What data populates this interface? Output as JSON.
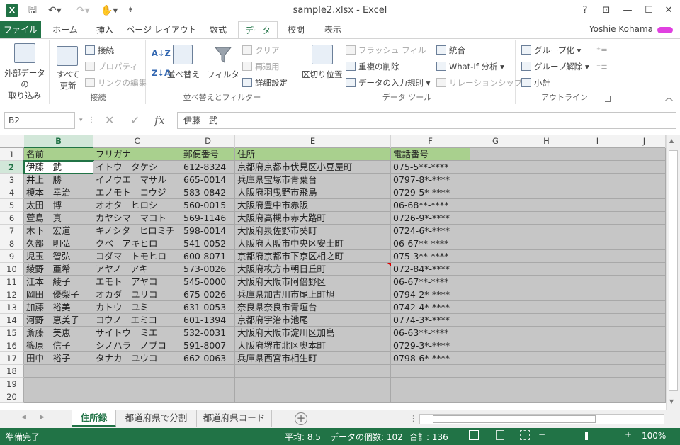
{
  "title_bar": {
    "app_icon": "X",
    "window_title": "sample2.xlsx - Excel",
    "help": "?",
    "ribbon_display": "⊡",
    "minimize": "—",
    "maximize": "☐",
    "close": "✕"
  },
  "tabs": [
    "ファイル",
    "ホーム",
    "挿入",
    "ページ レイアウト",
    "数式",
    "データ",
    "校閲",
    "表示"
  ],
  "active_tab": "データ",
  "user": "Yoshie Kohama",
  "ribbon": {
    "external": {
      "label": "外部データの\n取り込み"
    },
    "connections": {
      "refresh": "すべて\n更新",
      "connect": "接続",
      "properties": "プロパティ",
      "edit_links": "リンクの編集",
      "group_label": "接続"
    },
    "sort": {
      "az": "A↓Z",
      "za": "Z↓A",
      "sort": "並べ替え",
      "filter": "フィルター",
      "clear": "クリア",
      "reapply": "再適用",
      "advanced": "詳細設定",
      "group_label": "並べ替えとフィルター"
    },
    "tools": {
      "text_to_columns": "区切り位置",
      "flash_fill": "フラッシュ フィル",
      "remove_dup": "重複の削除",
      "validation": "データの入力規則",
      "consolidate": "統合",
      "whatif": "What-If 分析",
      "relationships": "リレーションシップ",
      "group_label": "データ ツール"
    },
    "outline": {
      "group": "グループ化",
      "ungroup": "グループ解除",
      "subtotal": "小計",
      "group_label": "アウトライン"
    }
  },
  "formula_bar": {
    "namebox": "B2",
    "cancel": "✕",
    "enter": "✓",
    "fx": "fx",
    "content": "伊藤　武"
  },
  "columns": [
    "B",
    "C",
    "D",
    "E",
    "F",
    "G",
    "H",
    "I",
    "J"
  ],
  "rows": [
    "1",
    "2",
    "3",
    "4",
    "5",
    "6",
    "7",
    "8",
    "9",
    "10",
    "11",
    "12",
    "13",
    "14",
    "15",
    "16",
    "17",
    "18",
    "19",
    "20"
  ],
  "table": {
    "headers": [
      "名前",
      "フリガナ",
      "郵便番号",
      "住所",
      "電話番号"
    ],
    "records": [
      [
        "伊藤　武",
        "イトウ　タケシ",
        "612-8324",
        "京都府京都市伏見区小豆屋町",
        "075-5**-****"
      ],
      [
        "井上　勝",
        "イノウエ　マサル",
        "665-0014",
        "兵庫県宝塚市青葉台",
        "0797-8*-****"
      ],
      [
        "榎本　幸治",
        "エノモト　コウジ",
        "583-0842",
        "大阪府羽曳野市飛鳥",
        "0729-5*-****"
      ],
      [
        "太田　博",
        "オオタ　ヒロシ",
        "560-0015",
        "大阪府豊中市赤阪",
        "06-68**-****"
      ],
      [
        "萱島　真",
        "カヤシマ　マコト",
        "569-1146",
        "大阪府高槻市赤大路町",
        "0726-9*-****"
      ],
      [
        "木下　宏道",
        "キノシタ　ヒロミチ",
        "598-0014",
        "大阪府泉佐野市葵町",
        "0724-6*-****"
      ],
      [
        "久部　明弘",
        "クベ　アキヒロ",
        "541-0052",
        "大阪府大阪市中央区安土町",
        "06-67**-****"
      ],
      [
        "児玉　智弘",
        "コダマ　トモヒロ",
        "600-8071",
        "京都府京都市下京区相之町",
        "075-3**-****"
      ],
      [
        "綾野　亜希",
        "アヤノ　アキ",
        "573-0026",
        "大阪府枚方市朝日丘町",
        "072-84*-****"
      ],
      [
        "江本　綾子",
        "エモト　アヤコ",
        "545-0000",
        "大阪府大阪市阿倍野区",
        "06-67**-****"
      ],
      [
        "岡田　優梨子",
        "オカダ　ユリコ",
        "675-0026",
        "兵庫県加古川市尾上町旭",
        "0794-2*-****"
      ],
      [
        "加藤　裕美",
        "カトウ　ユミ",
        "631-0053",
        "奈良県奈良市青垣台",
        "0742-4*-****"
      ],
      [
        "河野　恵美子",
        "コウノ　エミコ",
        "601-1394",
        "京都府宇治市池尾",
        "0774-3*-****"
      ],
      [
        "斎藤　美恵",
        "サイトウ　ミエ",
        "532-0031",
        "大阪府大阪市淀川区加島",
        "06-63**-****"
      ],
      [
        "篠原　信子",
        "シノハラ　ノブコ",
        "591-8007",
        "大阪府堺市北区奥本町",
        "0729-3*-****"
      ],
      [
        "田中　裕子",
        "タナカ　ユウコ",
        "662-0063",
        "兵庫県西宮市相生町",
        "0798-6*-****"
      ]
    ]
  },
  "sheets": [
    "住所録",
    "都道府県で分割",
    "都道府県コード"
  ],
  "active_sheet": "住所録",
  "status": {
    "ready": "準備完了",
    "average": "平均: 8.5",
    "count": "データの個数: 102",
    "sum": "合計: 136",
    "zoom": "100%"
  },
  "colors": {
    "accent": "#217346",
    "header_fill": "#a9d08e",
    "data_fill": "#c6c6c6"
  }
}
